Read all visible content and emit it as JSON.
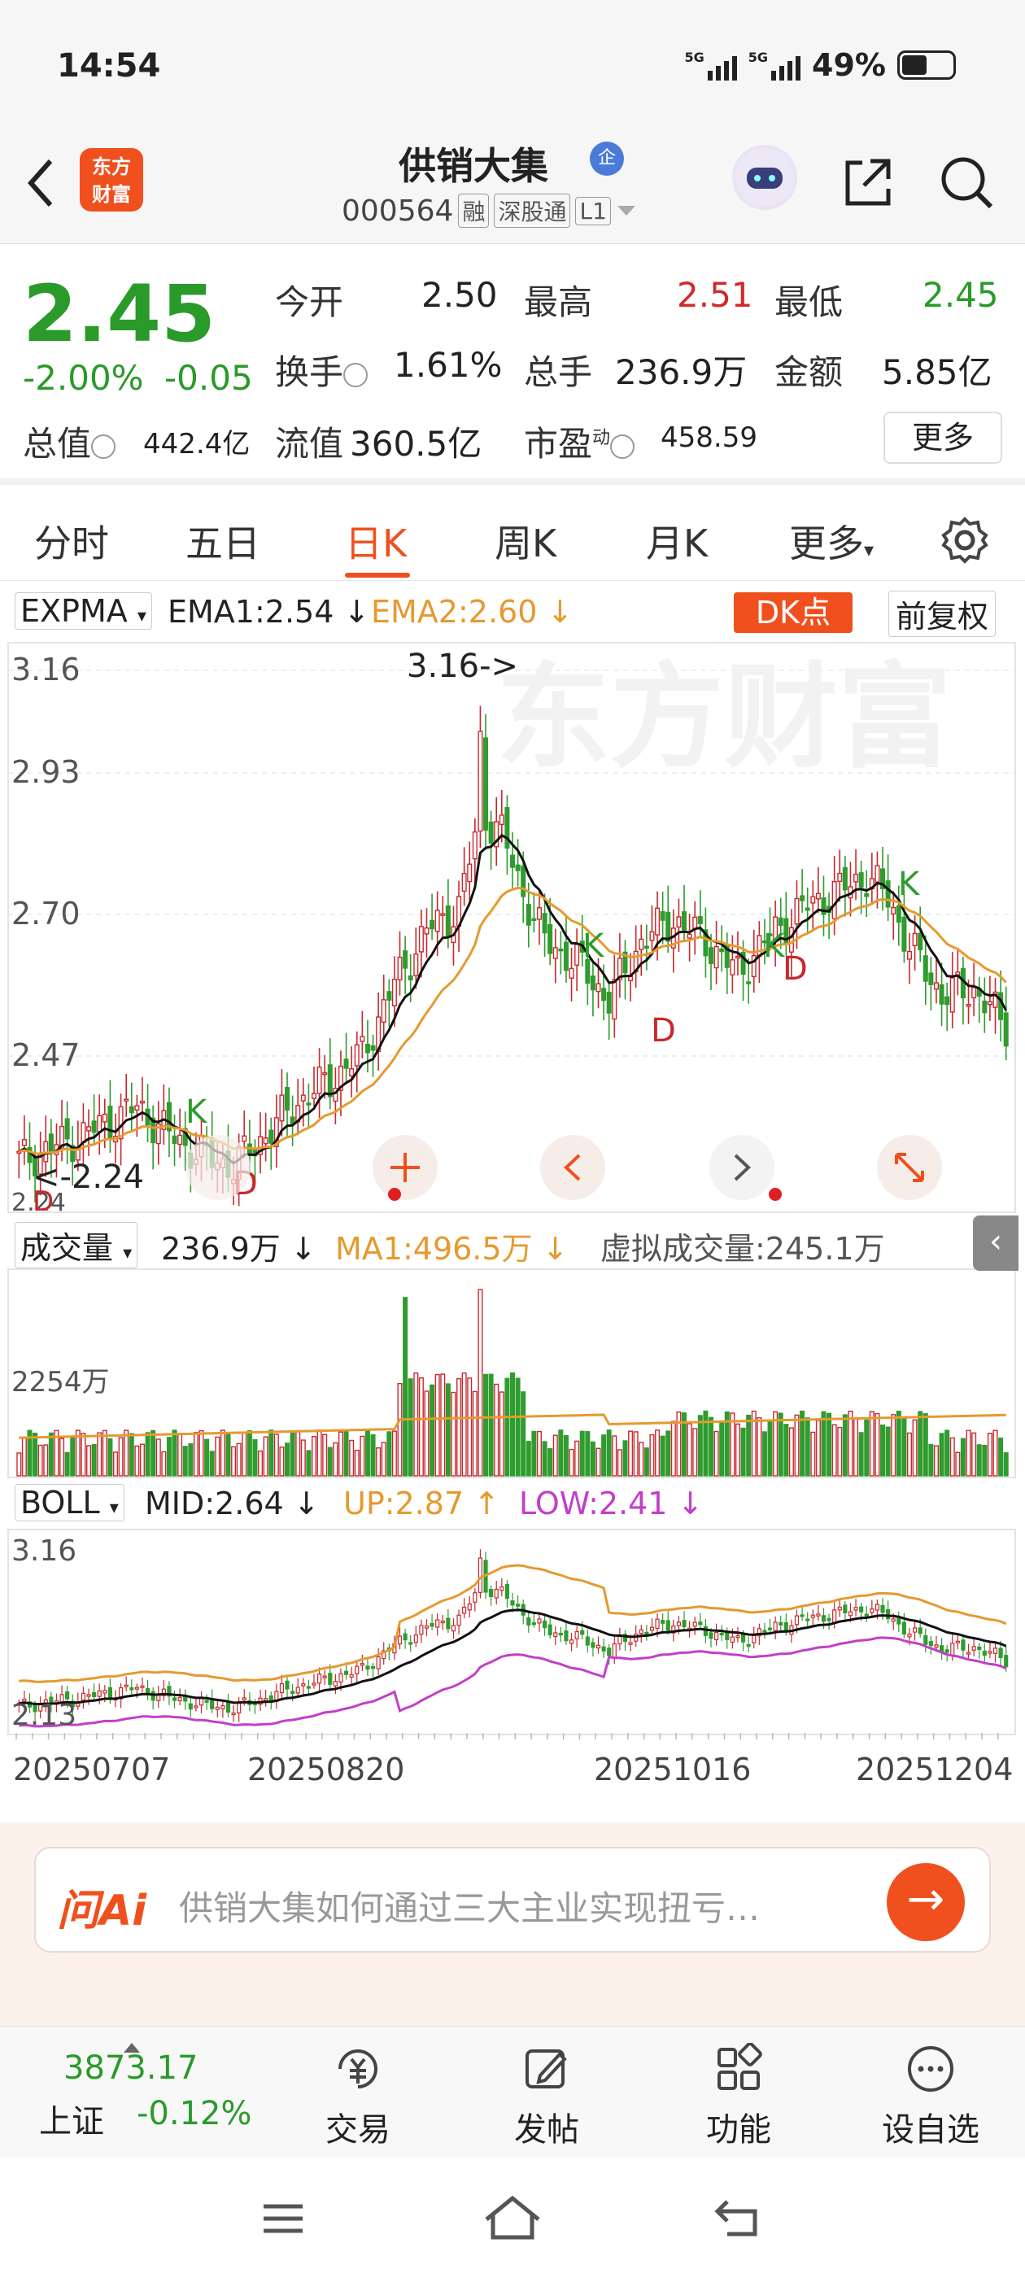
{
  "status": {
    "time": "14:54",
    "net1": "5G",
    "net2": "5G",
    "battery": "49%"
  },
  "header": {
    "logo_line1": "东方",
    "logo_line2": "财富",
    "stock_name": "供销大集",
    "badge": "企",
    "code": "000564",
    "tags": [
      "融",
      "深股通",
      "L1"
    ]
  },
  "quote": {
    "price": "2.45",
    "change_pct": "-2.00%",
    "change": "-0.05",
    "rows": [
      [
        {
          "l": "今开",
          "v": "2.50",
          "c": "plain"
        },
        {
          "l": "最高",
          "v": "2.51",
          "c": "red"
        },
        {
          "l": "最低",
          "v": "2.45",
          "c": "grn"
        }
      ],
      [
        {
          "l": "换手",
          "v": "1.61%",
          "c": "plain"
        },
        {
          "l": "总手",
          "v": "236.9万",
          "c": "plain"
        },
        {
          "l": "金额",
          "v": "5.85亿",
          "c": "plain"
        }
      ]
    ],
    "total_value_label": "总值",
    "total_value": "442.4亿",
    "float_label": "流值",
    "float_value": "360.5亿",
    "pe_label": "市盈",
    "pe_sup": "动",
    "pe_value": "458.59",
    "more": "更多"
  },
  "tabs": [
    "分时",
    "五日",
    "日K",
    "周K",
    "月K",
    "更多"
  ],
  "active_tab": "日K",
  "ema": {
    "name": "EXPMA",
    "ema1": "EMA1:2.54 ↓",
    "ema2": "EMA2:2.60 ↓",
    "dk": "DK点",
    "adjust": "前复权"
  },
  "vol": {
    "name": "成交量",
    "value": "236.9万 ↓",
    "ma1": "MA1:496.5万 ↓",
    "virtual": "虚拟成交量:245.1万",
    "axis_top": "2254万"
  },
  "boll": {
    "name": "BOLL",
    "mid": "MID:2.64 ↓",
    "up": "UP:2.87 ↑",
    "low": "LOW:2.41 ↓",
    "axis_top": "3.16",
    "axis_bottom": "2.13"
  },
  "colors": {
    "up": "#c8282d",
    "down": "#2e9c2e",
    "ema1": "#111111",
    "ema2": "#e59a2f",
    "boll_low": "#c23fc9",
    "accent": "#f0501e"
  },
  "chart_data": [
    {
      "type": "candlestick",
      "title": "日K",
      "y_ticks": [
        "3.16",
        "2.93",
        "2.70",
        "2.47",
        "2.24"
      ],
      "ylim": [
        2.17,
        3.2
      ],
      "annotations": [
        {
          "text": "3.16->"
        },
        {
          "text": "<-2.24"
        },
        {
          "text": "K"
        },
        {
          "text": "K"
        },
        {
          "text": "K"
        },
        {
          "text": "K"
        },
        {
          "text": "D"
        },
        {
          "text": "D"
        },
        {
          "text": "D"
        },
        {
          "text": "D"
        }
      ],
      "x_dates": [
        "20250707",
        "20250820",
        "20251016",
        "20251204"
      ],
      "series": [
        {
          "name": "EMA1",
          "last": "2.54"
        },
        {
          "name": "EMA2",
          "last": "2.60"
        }
      ]
    },
    {
      "type": "bar",
      "title": "成交量",
      "y_max_label": "2254万"
    },
    {
      "type": "line",
      "title": "BOLL",
      "series": [
        {
          "name": "MID"
        },
        {
          "name": "UP"
        },
        {
          "name": "LOW"
        }
      ]
    }
  ],
  "ai": {
    "logo": "问Ai",
    "prompt": "供销大集如何通过三大主业实现扭亏…"
  },
  "bottom": {
    "index_value": "3873.17",
    "index_name": "上证",
    "index_change": "-0.12%",
    "items": [
      "交易",
      "发帖",
      "功能",
      "设自选"
    ]
  }
}
